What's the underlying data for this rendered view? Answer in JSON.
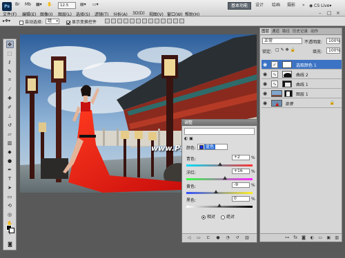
{
  "menubar": {
    "logo": "Ps",
    "zoom": "12.5",
    "menus": [
      "文件(F)",
      "编辑(E)",
      "图像(I)",
      "图层(L)",
      "选择(S)",
      "滤镜(T)",
      "分析(A)",
      "3D(D)",
      "视图(V)",
      "窗口(W)",
      "帮助(H)"
    ],
    "workspaces": [
      "基本功能",
      "设计",
      "绘画",
      "摄影"
    ],
    "more": "»",
    "cslive": "CS Live",
    "window_controls": [
      "–",
      "□",
      "×"
    ]
  },
  "options": {
    "auto_select_label": "自动选择:",
    "auto_select_value": "组",
    "show_transform_label": "显示变换控件"
  },
  "document": {
    "watermark": "www.Psjia.com"
  },
  "adjustments": {
    "title": "调整",
    "color_label": "颜色:",
    "color_value": "蓝色",
    "rows": [
      {
        "label": "青色:",
        "value": "+2",
        "pct": "%",
        "level": 0.51
      },
      {
        "label": "洋红:",
        "value": "+16",
        "pct": "%",
        "level": 0.58
      },
      {
        "label": "黄色:",
        "value": "-9",
        "pct": "%",
        "level": 0.45
      },
      {
        "label": "黑色:",
        "value": "0",
        "pct": "%",
        "level": 0.5
      }
    ],
    "relative": "相对",
    "absolute": "绝对"
  },
  "layers_panel": {
    "tabs": [
      "图层",
      "通道",
      "路径",
      "历史记录",
      "动作"
    ],
    "blend_mode": "正常",
    "opacity_label": "不透明度:",
    "opacity": "100%",
    "lock_label": "锁定:",
    "fill_label": "填充:",
    "fill": "100%",
    "layers": [
      {
        "name": "选取颜色 1",
        "icon": "✓"
      },
      {
        "name": "曲线 2",
        "icon": "∿"
      },
      {
        "name": "曲线 1",
        "icon": "∿"
      },
      {
        "name": "图层 1",
        "icon": ""
      },
      {
        "name": "背景",
        "icon": ""
      }
    ]
  },
  "colors": {
    "accent": "#3c73c4",
    "foreground": "#000000",
    "background": "#ffffff"
  }
}
